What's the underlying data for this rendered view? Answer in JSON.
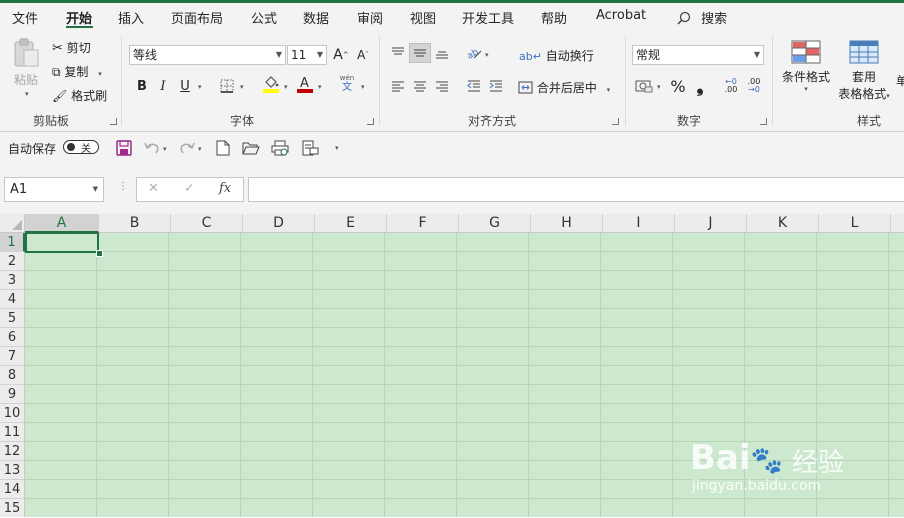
{
  "tabs": [
    "文件",
    "开始",
    "插入",
    "页面布局",
    "公式",
    "数据",
    "审阅",
    "视图",
    "开发工具",
    "帮助",
    "Acrobat"
  ],
  "search_label": "搜索",
  "clipboard": {
    "paste": "粘贴",
    "cut": "剪切",
    "copy": "复制",
    "format_painter": "格式刷",
    "group": "剪贴板"
  },
  "font": {
    "name": "等线",
    "size": "11",
    "grow": "A",
    "shrink": "A",
    "bold": "B",
    "italic": "I",
    "underline": "U",
    "group": "字体",
    "pinyin": "wén",
    "pinyin_char": "文"
  },
  "alignment": {
    "wrap": "自动换行",
    "merge": "合并后居中",
    "group": "对齐方式"
  },
  "number": {
    "format": "常规",
    "percent": "%",
    "comma": "❟",
    "inc": "←0",
    "inc2": ".00",
    "dec": ".00",
    "dec2": "→0",
    "group": "数字"
  },
  "styles": {
    "conditional": "条件格式",
    "table1": "套用",
    "table2": "表格格式",
    "group": "样式",
    "next": "单"
  },
  "qat": {
    "autosave": "自动保存",
    "toggle": "关"
  },
  "formula_bar": {
    "name_box": "A1",
    "cancel": "✕",
    "enter": "✓",
    "fx": "fx",
    "formula": ""
  },
  "columns": [
    "A",
    "B",
    "C",
    "D",
    "E",
    "F",
    "G",
    "H",
    "I",
    "J",
    "K",
    "L"
  ],
  "rows": [
    "1",
    "2",
    "3",
    "4",
    "5",
    "6",
    "7",
    "8",
    "9",
    "10",
    "11",
    "12",
    "13",
    "14",
    "15"
  ],
  "watermark": {
    "logo": "Bai",
    "logo2": "du",
    "cn": "经验",
    "url": "jingyan.baidu.com"
  },
  "colors": {
    "accent": "#217346",
    "sheet": "#cce8cf",
    "fill_yellow": "#ffff00",
    "font_red": "#c00000"
  }
}
